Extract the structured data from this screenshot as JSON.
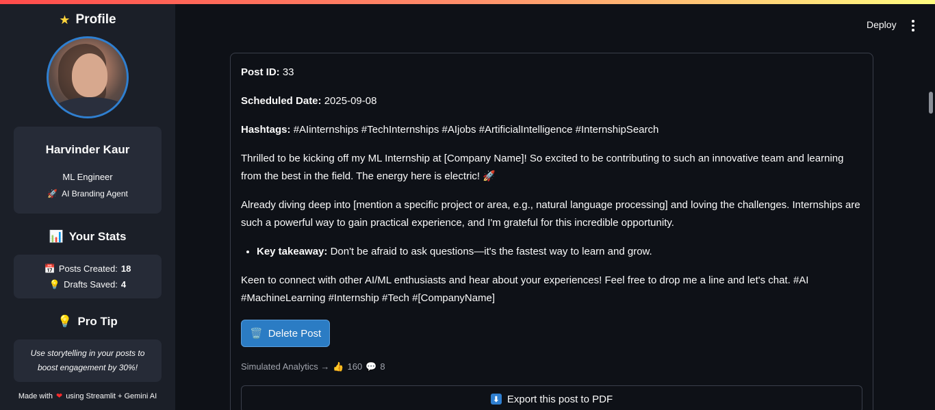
{
  "sidebar": {
    "title": "Profile",
    "name": "Harvinder Kaur",
    "role": "ML Engineer",
    "agent": "AI Branding Agent",
    "stats_title": "Your Stats",
    "stats": {
      "posts_label": "Posts Created:",
      "posts_value": "18",
      "drafts_label": "Drafts Saved:",
      "drafts_value": "4"
    },
    "tip_title": "Pro Tip",
    "tip_text": "Use storytelling in your posts to boost engagement by 30%!",
    "made_with_prefix": "Made with",
    "made_with_suffix": "using Streamlit + Gemini AI"
  },
  "header": {
    "deploy_label": "Deploy"
  },
  "post": {
    "id_label": "Post ID:",
    "id_value": "33",
    "date_label": "Scheduled Date:",
    "date_value": "2025-09-08",
    "hashtags_label": "Hashtags:",
    "hashtags_value": "#AIinternships #TechInternships #AIjobs #ArtificialIntelligence #InternshipSearch",
    "paragraph1": "Thrilled to be kicking off my ML Internship at [Company Name]! So excited to be contributing to such an innovative team and learning from the best in the field. The energy here is electric! 🚀",
    "paragraph2": "Already diving deep into [mention a specific project or area, e.g., natural language processing] and loving the challenges. Internships are such a powerful way to gain practical experience, and I'm grateful for this incredible opportunity.",
    "bullet_label": "Key takeaway:",
    "bullet_text": "Don't be afraid to ask questions—it's the fastest way to learn and grow.",
    "paragraph3": "Keen to connect with other AI/ML enthusiasts and hear about your experiences! Feel free to drop me a line and let's chat. #AI #MachineLearning #Internship #Tech #[CompanyName]",
    "delete_label": "Delete Post",
    "analytics_label": "Simulated Analytics →",
    "likes": "160",
    "comments": "8",
    "export_label": "Export this post to PDF"
  },
  "icons": {
    "star": "star-icon",
    "rocket": "rocket-icon",
    "chart": "bar-chart-icon",
    "calendar": "calendar-icon",
    "bulb": "lightbulb-icon",
    "trash": "trash-icon",
    "thumbs_up": "thumbs-up-icon",
    "comment": "comment-icon",
    "download": "download-icon",
    "heart": "heart-icon"
  },
  "colors": {
    "accent": "#2b7cc4",
    "background": "#0e1117",
    "sidebar": "#1b1f28"
  }
}
